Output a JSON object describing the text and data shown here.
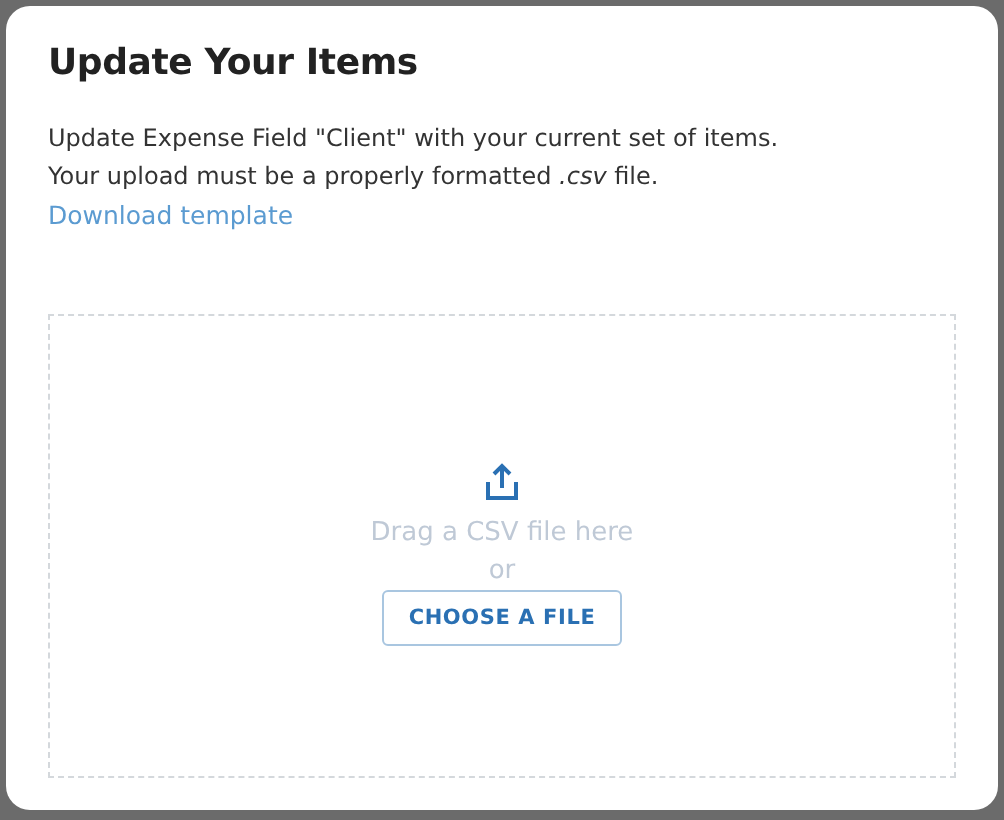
{
  "dialog": {
    "title": "Update Your Items",
    "description": "Update Expense Field \"Client\" with your current set of items.\nYour upload must be a properly formatted *.csv* file.",
    "link": "Download template"
  },
  "dropzone": {
    "prompt": "Drag a CSV file here",
    "separator": "or",
    "button": "CHOOSE A FILE"
  }
}
